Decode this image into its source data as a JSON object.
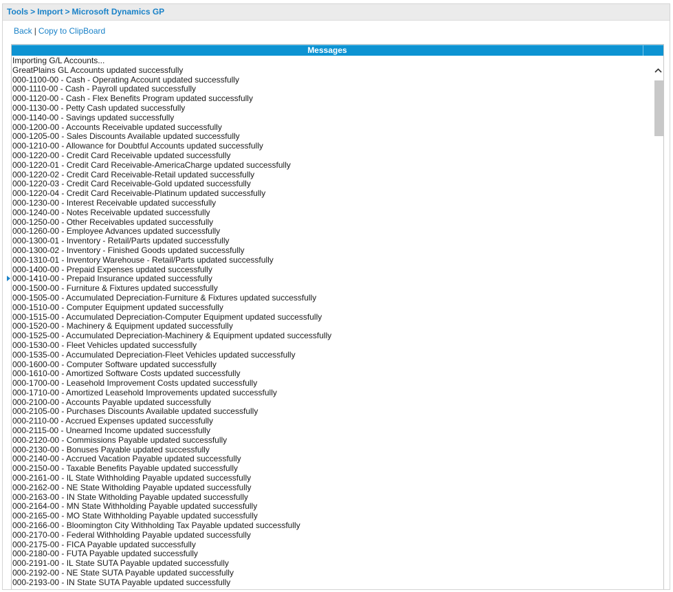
{
  "breadcrumb": {
    "items": [
      "Tools",
      "Import",
      "Microsoft Dynamics GP"
    ],
    "separator": ">"
  },
  "links": {
    "back": "Back",
    "divider": "|",
    "copy": "Copy to ClipBoard"
  },
  "panel": {
    "header": "Messages",
    "messages": [
      "Importing G/L Accounts...",
      "GreatPlains GL Accounts updated successfully",
      "000-1100-00 - Cash - Operating Account updated successfully",
      "000-1110-00 - Cash - Payroll updated successfully",
      "000-1120-00 - Cash - Flex Benefits Program updated successfully",
      "000-1130-00 - Petty Cash updated successfully",
      "000-1140-00 - Savings updated successfully",
      "000-1200-00 - Accounts Receivable updated successfully",
      "000-1205-00 - Sales Discounts Available updated successfully",
      "000-1210-00 - Allowance for Doubtful Accounts updated successfully",
      "000-1220-00 - Credit Card Receivable updated successfully",
      "000-1220-01 - Credit Card Receivable-AmericaCharge updated successfully",
      "000-1220-02 - Credit Card Receivable-Retail updated successfully",
      "000-1220-03 - Credit Card Receivable-Gold updated successfully",
      "000-1220-04 - Credit Card Receivable-Platinum updated successfully",
      "000-1230-00 - Interest Receivable updated successfully",
      "000-1240-00 - Notes Receivable updated successfully",
      "000-1250-00 - Other Receivables updated successfully",
      "000-1260-00 - Employee Advances updated successfully",
      "000-1300-01 - Inventory - Retail/Parts updated successfully",
      "000-1300-02 - Inventory - Finished Goods updated successfully",
      "000-1310-01 - Inventory Warehouse - Retail/Parts updated successfully",
      "000-1400-00 - Prepaid Expenses updated successfully",
      "000-1410-00 - Prepaid Insurance updated successfully",
      "000-1500-00 - Furniture & Fixtures updated successfully",
      "000-1505-00 - Accumulated Depreciation-Furniture & Fixtures updated successfully",
      "000-1510-00 - Computer Equipment updated successfully",
      "000-1515-00 - Accumulated Depreciation-Computer Equipment updated successfully",
      "000-1520-00 - Machinery & Equipment updated successfully",
      "000-1525-00 - Accumulated Depreciation-Machinery & Equipment updated successfully",
      "000-1530-00 - Fleet Vehicles updated successfully",
      "000-1535-00 - Accumulated Depreciation-Fleet Vehicles updated successfully",
      "000-1600-00 - Computer Software updated successfully",
      "000-1610-00 - Amortized Software Costs updated successfully",
      "000-1700-00 - Leasehold Improvement Costs updated successfully",
      "000-1710-00 - Amortized Leasehold Improvements updated successfully",
      "000-2100-00 - Accounts Payable updated successfully",
      "000-2105-00 - Purchases Discounts Available updated successfully",
      "000-2110-00 - Accrued Expenses updated successfully",
      "000-2115-00 - Unearned Income updated successfully",
      "000-2120-00 - Commissions Payable updated successfully",
      "000-2130-00 - Bonuses Payable updated successfully",
      "000-2140-00 - Accrued Vacation Payable updated successfully",
      "000-2150-00 - Taxable Benefits Payable updated successfully",
      "000-2161-00 - IL State Withholding Payable updated successfully",
      "000-2162-00 - NE State Witholding Payable updated successfully",
      "000-2163-00 - IN State Witholding Payable updated successfully",
      "000-2164-00 - MN State Withholding Payable updated successfully",
      "000-2165-00 - MO State Withholding Payable updated successfully",
      "000-2166-00 - Bloomington City Withholding Tax Payable updated successfully",
      "000-2170-00 - Federal Withholding Payable updated successfully",
      "000-2175-00 - FICA Payable updated successfully",
      "000-2180-00 - FUTA Payable updated successfully",
      "000-2191-00 - IL State SUTA Payable updated successfully",
      "000-2192-00 - NE State SUTA Payable updated successfully",
      "000-2193-00 - IN State SUTA Payable updated successfully"
    ]
  },
  "colors": {
    "accent": "#1a82c8",
    "header_bg": "#0d93d2"
  }
}
